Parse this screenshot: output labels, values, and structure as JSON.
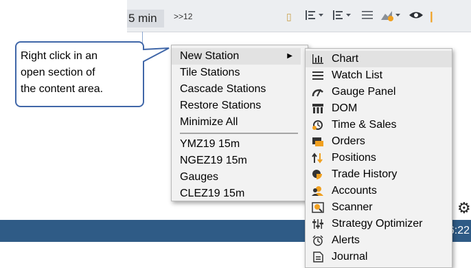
{
  "toolbar": {
    "interval": "5 min",
    "skip": ">>12"
  },
  "callout": {
    "lines": [
      "Right click in an",
      "open section of",
      "the content area."
    ]
  },
  "context_menu": {
    "items": [
      {
        "label": "New Station"
      },
      {
        "label": "Tile Stations"
      },
      {
        "label": "Cascade Stations"
      },
      {
        "label": "Restore Stations"
      },
      {
        "label": "Minimize All"
      },
      {
        "label": "YMZ19 15m"
      },
      {
        "label": "NGEZ19 15m"
      },
      {
        "label": "Gauges"
      },
      {
        "label": "CLEZ19 15m"
      }
    ]
  },
  "submenu": {
    "items": [
      {
        "label": "Chart",
        "icon": "chart-icon"
      },
      {
        "label": "Watch List",
        "icon": "watch-list-icon"
      },
      {
        "label": "Gauge Panel",
        "icon": "gauge-icon"
      },
      {
        "label": "DOM",
        "icon": "dom-icon"
      },
      {
        "label": "Time & Sales",
        "icon": "time-sales-icon"
      },
      {
        "label": "Orders",
        "icon": "orders-icon"
      },
      {
        "label": "Positions",
        "icon": "positions-icon"
      },
      {
        "label": "Trade History",
        "icon": "trade-history-icon"
      },
      {
        "label": "Accounts",
        "icon": "accounts-icon"
      },
      {
        "label": "Scanner",
        "icon": "scanner-icon"
      },
      {
        "label": "Strategy Optimizer",
        "icon": "strategy-optimizer-icon"
      },
      {
        "label": "Alerts",
        "icon": "alerts-icon"
      },
      {
        "label": "Journal",
        "icon": "journal-icon"
      }
    ]
  },
  "status": {
    "time": "6:22"
  },
  "colors": {
    "statusbar": "#2f5b86",
    "callout_border": "#3f66a8",
    "menu_bg": "#f2f2f2",
    "highlight": "#e2e2e2",
    "accent_orange": "#f0a020"
  }
}
